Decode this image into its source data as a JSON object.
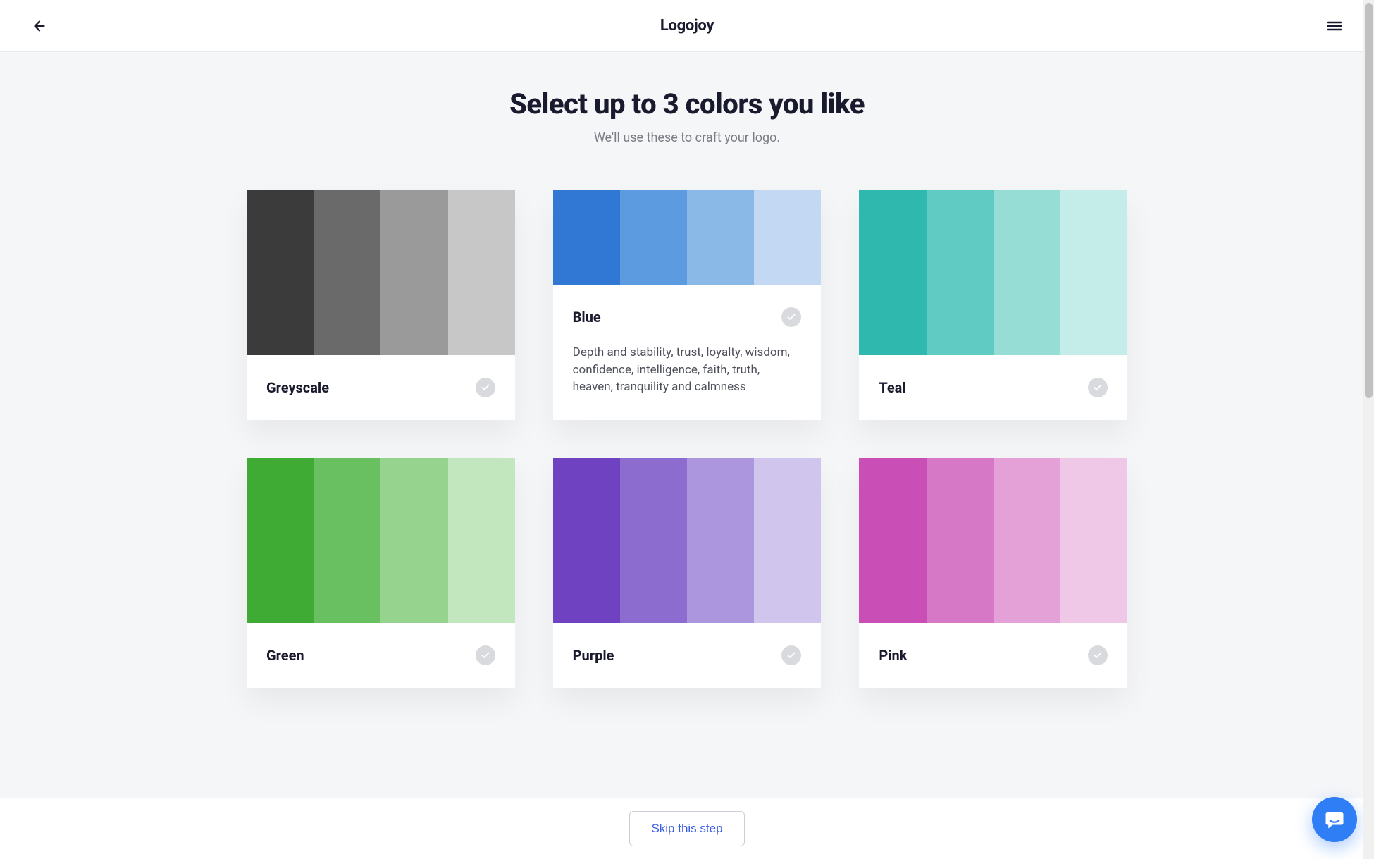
{
  "header": {
    "brand": "Logojoy"
  },
  "page": {
    "title": "Select up to 3 colors you like",
    "subtitle": "We'll use these to craft your logo."
  },
  "cards": [
    {
      "name": "Greyscale",
      "expanded": false,
      "swatches": [
        "#3b3b3b",
        "#6a6a6a",
        "#9a9a9a",
        "#c7c7c7"
      ]
    },
    {
      "name": "Blue",
      "expanded": true,
      "desc": "Depth and stability, trust, loyalty, wisdom, confidence, intelligence, faith, truth, heaven, tranquility and calmness",
      "swatches": [
        "#3078d3",
        "#5c9be0",
        "#8bb9e7",
        "#c2d8f3"
      ]
    },
    {
      "name": "Teal",
      "expanded": false,
      "swatches": [
        "#2fb9ae",
        "#5fcbc2",
        "#96ddd6",
        "#c4ece8"
      ]
    },
    {
      "name": "Green",
      "expanded": false,
      "swatches": [
        "#3faa34",
        "#69c061",
        "#95d38f",
        "#c2e6be"
      ]
    },
    {
      "name": "Purple",
      "expanded": false,
      "swatches": [
        "#6f42c1",
        "#8d6cd0",
        "#ac97de",
        "#d0c5ec"
      ]
    },
    {
      "name": "Pink",
      "expanded": false,
      "swatches": [
        "#c94fb6",
        "#d678c6",
        "#e3a1d7",
        "#efc8e7"
      ]
    }
  ],
  "footer": {
    "skip_label": "Skip this step"
  }
}
